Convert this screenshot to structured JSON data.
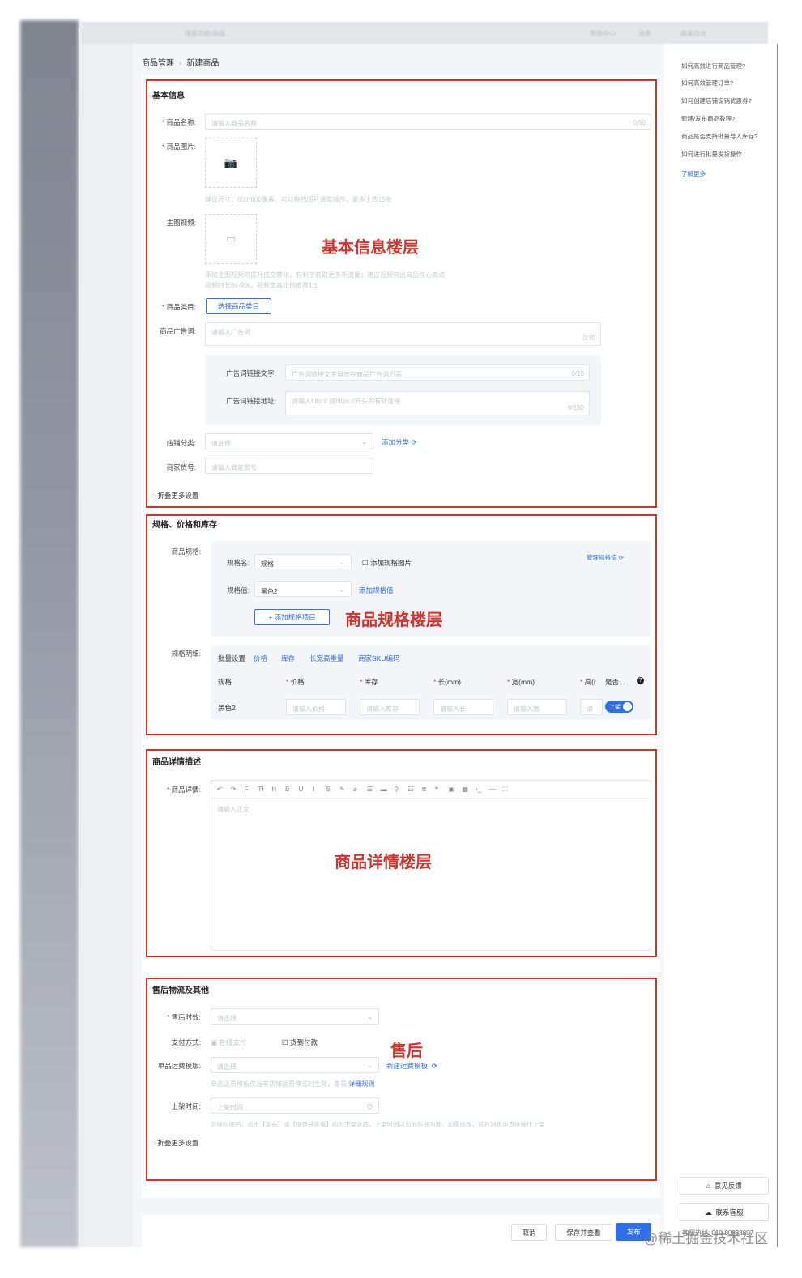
{
  "topbar": {
    "search_placeholder": "搜索功能/商品",
    "right_a": "帮助中心",
    "right_b": "消息",
    "right_c": "商家后台"
  },
  "breadcrumb": {
    "parent": "商品管理",
    "current": "新建商品"
  },
  "basic": {
    "title": "基本信息",
    "annotation": "基本信息楼层",
    "name_label": "商品名称:",
    "name_placeholder": "请输入商品名称",
    "name_count": "0/50",
    "image_label": "商品图片:",
    "image_hint": "建议尺寸：800*800像素，可以拖拽图片调整顺序，最多上传15张",
    "video_label": "主图视频:",
    "video_hint1": "添加主图视频可提升成交转化，有利于获取更多新流量；建议视频突出商品核心卖点",
    "video_hint2": "视频时长6s-90s，视频宽高比例推荐1:1",
    "category_label": "商品类目:",
    "category_button": "选择商品类目",
    "ad_label": "商品广告词:",
    "ad_placeholder": "请输入广告词",
    "ad_count": "0/70",
    "ad_link_text_label": "广告词链接文字:",
    "ad_link_text_placeholder": "广告词链接文字展示在商品广告词后面",
    "ad_link_text_count": "0/10",
    "ad_link_url_label": "广告词链接地址:",
    "ad_link_url_placeholder": "请输入http:// 或https://开头的有效连接",
    "ad_link_url_count": "0/150",
    "shop_cat_label": "店铺分类:",
    "shop_cat_placeholder": "请选择",
    "shop_cat_add": "添加分类",
    "sku_label": "商家货号:",
    "sku_placeholder": "请输入商家货号",
    "collapse": "折叠更多设置"
  },
  "spec": {
    "title": "规格、价格和库存",
    "annotation": "商品规格楼层",
    "spec_label": "商品规格:",
    "name_label": "规格名:",
    "name_value": "规格",
    "add_image": "添加规格图片",
    "manage": "管理规格值",
    "value_label": "规格值:",
    "value_value": "黑色2",
    "add_value": "添加规格值",
    "add_item": "+ 添加规格项目",
    "detail_label": "规格明细:",
    "batch": "批量设置",
    "batch_links": [
      "价格",
      "库存",
      "长宽高重量",
      "商家SKU编码"
    ],
    "columns": [
      "规格",
      "价格",
      "库存",
      "长(mm)",
      "宽(mm)",
      "高(r",
      "是否..."
    ],
    "row": {
      "spec": "黑色2",
      "price_ph": "请输入价格",
      "stock_ph": "请输入库存",
      "len_ph": "请输入长",
      "wid_ph": "请输入宽",
      "hei_ph": "请输",
      "toggle": "上架",
      "toggle_on": true
    }
  },
  "detail": {
    "title": "商品详情描述",
    "annotation": "商品详情楼层",
    "label": "商品详情:",
    "placeholder": "请输入正文",
    "toolbar": [
      "↶",
      "↷",
      "Ƒ",
      "TI",
      "H",
      "B",
      "U",
      "I",
      "S",
      "✎",
      "⌀",
      "☰",
      "▬",
      "⚲",
      "☷",
      "≣",
      "❝",
      "▣",
      "▦",
      "›_",
      "—",
      "⛶"
    ]
  },
  "after": {
    "title": "售后物流及其他",
    "annotation": "售后",
    "service_label": "售后时效:",
    "service_placeholder": "请选择",
    "pay_label": "支付方式:",
    "pay_online": "在线支付",
    "pay_cod": "货到付款",
    "freight_label": "单品运费模版:",
    "freight_placeholder": "请选择",
    "freight_new": "新建运费模板",
    "freight_hint": "单品运费模板仅当非店铺运费模式时生效，查看",
    "freight_rule": "详细规则",
    "time_label": "上架时间:",
    "time_placeholder": "上架时间",
    "time_hint": "选择时间后，点击【发布】或【保存并查看】均为下架状态，上架时间以当前时间为准，如需修改，可在列表中直接操作上架",
    "collapse": "折叠更多设置"
  },
  "footer": {
    "cancel": "取消",
    "save": "保存并查看",
    "publish": "发布"
  },
  "help": {
    "items": [
      "如何高效进行商品管理?",
      "如何高效管理订单?",
      "如何创建店铺促销优惠券?",
      "新建/发布商品教程?",
      "商品是否支持批量导入库存?",
      "如何进行批量发货操作"
    ],
    "more": "了解更多",
    "feedback": "意见反馈",
    "service": "联系客服",
    "hotline": "客服热线: 010-80838807"
  },
  "watermark": "@稀土掘金技术社区"
}
